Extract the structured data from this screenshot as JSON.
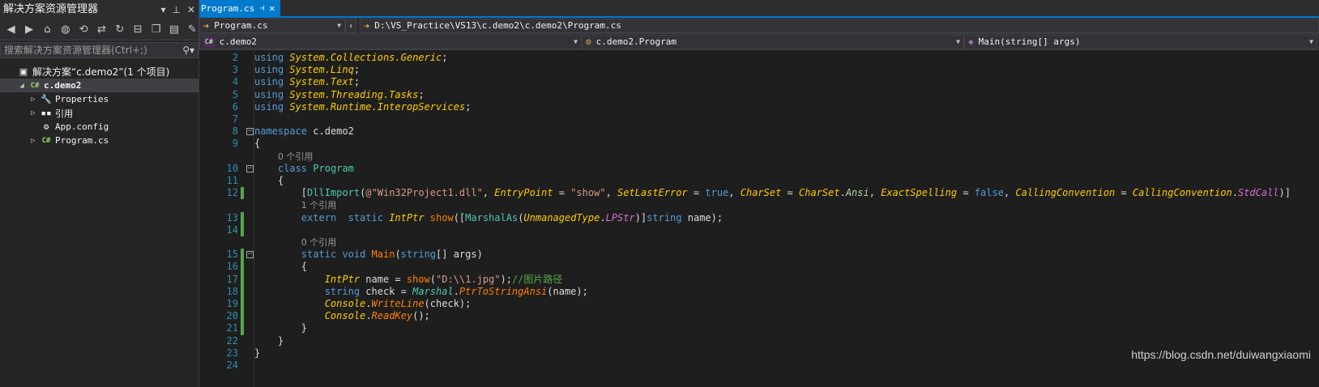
{
  "solution_explorer": {
    "title": "解决方案资源管理器",
    "title_controls": [
      "▾",
      "⊥",
      "✕"
    ],
    "search_placeholder": "搜索解决方案资源管理器(Ctrl+;)",
    "tree": [
      {
        "label": "解决方案“c.demo2”(1 个项目)",
        "icon": "solution-icon",
        "indent": 0
      },
      {
        "label": "c.demo2",
        "icon": "csharp-project-icon",
        "indent": 1,
        "selected": true,
        "expanded": true
      },
      {
        "label": "Properties",
        "icon": "wrench-icon",
        "indent": 2
      },
      {
        "label": "引用",
        "icon": "references-icon",
        "indent": 2
      },
      {
        "label": "App.config",
        "icon": "config-icon",
        "indent": 2
      },
      {
        "label": "Program.cs",
        "icon": "csharp-file-icon",
        "indent": 2
      }
    ]
  },
  "editor": {
    "tab": {
      "label": "Program.cs",
      "pin": "⊣",
      "close": "✕"
    },
    "file_dropdown": "Program.cs",
    "path": "D:\\VS_Practice\\VS13\\c.demo2\\c.demo2\\Program.cs",
    "project_dropdown": "c.demo2",
    "class_dropdown": "c.demo2.Program",
    "member_dropdown": "Main(string[] args)",
    "colors": {
      "keyword": "#569cd6",
      "type": "#4ec9b0",
      "string": "#d69d85",
      "method": "#ffcc00",
      "enum": "#b8d7a3",
      "comment": "#57a64a",
      "line_number": "#2b91af",
      "accent": "#007acc"
    },
    "lines": [
      {
        "n": "2",
        "html": "<span style='color:#569cd6'>using</span> <span style='color:#ffcc00;font-style:italic'>System.Collections.Generic</span>;",
        "fold": false,
        "changed": false
      },
      {
        "n": "3",
        "html": "<span style='color:#569cd6'>using</span> <span style='color:#ffcc00;font-style:italic'>System.Linq</span>;",
        "fold": false,
        "changed": false
      },
      {
        "n": "4",
        "html": "<span style='color:#569cd6'>using</span> <span style='color:#ffcc00;font-style:italic'>System.Text</span>;",
        "fold": false,
        "changed": false
      },
      {
        "n": "5",
        "html": "<span style='color:#569cd6'>using</span> <span style='color:#ffcc00;font-style:italic'>System.Threading.Tasks</span>;",
        "fold": false,
        "changed": false
      },
      {
        "n": "6",
        "html": "<span style='color:#569cd6'>using</span> <span style='color:#ffcc00;font-style:italic'>System.Runtime.InteropServices</span>;",
        "fold": false,
        "changed": false
      },
      {
        "n": "7",
        "html": "",
        "fold": false,
        "changed": false
      },
      {
        "n": "8",
        "html": "<span style='color:#569cd6'>namespace</span> <span style='color:#dcdcdc'>c.demo2</span>",
        "fold": true,
        "changed": false
      },
      {
        "n": "9",
        "html": "{",
        "fold": false,
        "changed": false
      },
      {
        "n": "",
        "html": "    <span class='ref'>0 个引用</span>",
        "fold": false,
        "changed": false
      },
      {
        "n": "10",
        "html": "    <span style='color:#569cd6'>class</span> <span style='color:#4ec9b0'>Program</span>",
        "fold": true,
        "changed": false
      },
      {
        "n": "11",
        "html": "    {",
        "fold": false,
        "changed": false
      },
      {
        "n": "12",
        "html": "        [<span style='color:#4ec9b0'>DllImport</span>(<span style='color:#d69d85'>@\"Win32Project1.dll\"</span>, <span style='color:#ffcc00;font-style:italic'>EntryPoint</span> = <span style='color:#d69d85'>\"show\"</span>, <span style='color:#ffcc00;font-style:italic'>SetLastError</span> = <span style='color:#569cd6'>true</span>, <span style='color:#ffcc00;font-style:italic'>CharSet</span> = <span style='color:#ffcc00;font-style:italic'>CharSet</span>.<span style='color:#b8d7a3;font-style:italic'>Ansi</span>, <span style='color:#ffcc00;font-style:italic'>ExactSpelling</span> = <span style='color:#569cd6'>false</span>, <span style='color:#ffcc00;font-style:italic'>CallingConvention</span> = <span style='color:#ffcc00;font-style:italic'>CallingConvention</span>.<span style='color:#d670d6;font-style:italic'>StdCall</span>)]",
        "fold": false,
        "changed": true
      },
      {
        "n": "",
        "html": "        <span class='ref'>1 个引用</span>",
        "fold": false,
        "changed": false
      },
      {
        "n": "13",
        "html": "        <span style='color:#569cd6'>extern</span>  <span style='color:#569cd6'>static</span> <span style='color:#ffcc00;font-style:italic'>IntPtr</span> <span style='color:#ff8000'>show</span>([<span style='color:#4ec9b0'>MarshalAs</span>(<span style='color:#ffcc00;font-style:italic'>UnmanagedType</span>.<span style='color:#d670d6;font-style:italic'>LPStr</span>)]<span style='color:#569cd6'>string</span> name);",
        "fold": false,
        "changed": true
      },
      {
        "n": "14",
        "html": "",
        "fold": false,
        "changed": true
      },
      {
        "n": "",
        "html": "        <span class='ref'>0 个引用</span>",
        "fold": false,
        "changed": false
      },
      {
        "n": "15",
        "html": "        <span style='color:#569cd6'>static</span> <span style='color:#569cd6'>void</span> <span style='color:#ff8000'>Main</span>(<span style='color:#569cd6'>string</span>[] args)",
        "fold": true,
        "changed": true
      },
      {
        "n": "16",
        "html": "        {",
        "fold": false,
        "changed": true
      },
      {
        "n": "17",
        "html": "            <span style='color:#ffcc00;font-style:italic'>IntPtr</span> name = <span style='color:#ff8000'>show</span>(<span style='color:#d69d85'>\"D:\\\\1.jpg\"</span>);<span style='color:#57a64a'>//图片路径</span>",
        "fold": false,
        "changed": true
      },
      {
        "n": "18",
        "html": "            <span style='color:#569cd6'>string</span> check = <span style='color:#4ec9b0;font-style:italic'>Marshal</span>.<span style='color:#ff8000;font-style:italic'>PtrToStringAnsi</span>(name);",
        "fold": false,
        "changed": true
      },
      {
        "n": "19",
        "html": "            <span style='color:#ffcc00;font-style:italic'>Console</span>.<span style='color:#ff8000;font-style:italic'>WriteLine</span>(check);",
        "fold": false,
        "changed": true
      },
      {
        "n": "20",
        "html": "            <span style='color:#ffcc00;font-style:italic'>Console</span>.<span style='color:#ff8000;font-style:italic'>ReadKey</span>();",
        "fold": false,
        "changed": true
      },
      {
        "n": "21",
        "html": "        }",
        "fold": false,
        "changed": true
      },
      {
        "n": "22",
        "html": "    }",
        "fold": false,
        "changed": false
      },
      {
        "n": "23",
        "html": "}",
        "fold": false,
        "changed": false
      },
      {
        "n": "24",
        "html": "",
        "fold": false,
        "changed": false
      }
    ]
  },
  "watermark": "https://blog.csdn.net/duiwangxiaomi"
}
